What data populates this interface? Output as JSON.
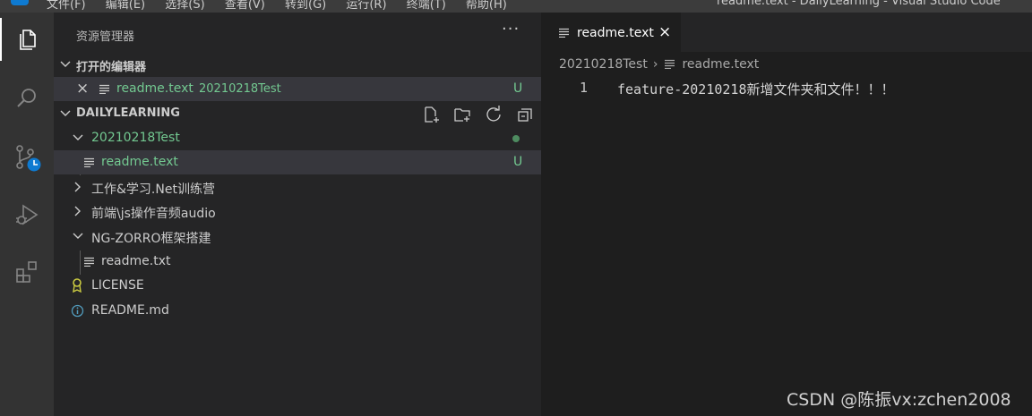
{
  "menubar": {
    "items": [
      "文件(F)",
      "编辑(E)",
      "选择(S)",
      "查看(V)",
      "转到(G)",
      "运行(R)",
      "终端(T)",
      "帮助(H)"
    ],
    "window_title": "readme.text - DailyLearning - Visual Studio Code"
  },
  "activity_bar": {
    "icons": [
      "explorer-icon",
      "search-icon",
      "source-control-icon",
      "run-debug-icon",
      "extensions-icon"
    ],
    "accent_color": "#ffffff",
    "badge_color": "#0e7ad1"
  },
  "explorer": {
    "title": "资源管理器",
    "more": "···",
    "open_editors": {
      "title": "打开的编辑器",
      "items": [
        {
          "close": "×",
          "name": "readme.text",
          "folder": "20210218Test",
          "status": "U"
        }
      ]
    },
    "workspace": {
      "title": "DAILYLEARNING",
      "tools": [
        "new-file-icon",
        "new-folder-icon",
        "refresh-icon",
        "collapse-all-icon"
      ],
      "tree": [
        {
          "name": "20210218Test",
          "type": "folder",
          "expanded": true,
          "status": "dot"
        },
        {
          "name": "readme.text",
          "type": "file",
          "status": "U"
        },
        {
          "name": "工作&学习.Net训练营",
          "type": "folder",
          "expanded": false
        },
        {
          "name": "前端\\js操作音频audio",
          "type": "folder",
          "expanded": false
        },
        {
          "name": "NG-ZORRO框架搭建",
          "type": "folder",
          "expanded": true
        },
        {
          "name": "readme.txt",
          "type": "file"
        },
        {
          "name": "LICENSE",
          "type": "file",
          "icon": "license-icon"
        },
        {
          "name": "README.md",
          "type": "file",
          "icon": "info-icon"
        }
      ]
    }
  },
  "editor": {
    "tab": {
      "label": "readme.text",
      "close": "×"
    },
    "breadcrumb": {
      "folder": "20210218Test",
      "separator": "›",
      "file": "readme.text"
    },
    "lines": [
      {
        "number": "1",
        "text": "feature-20210218新增文件夹和文件！！！"
      }
    ]
  },
  "watermark": "CSDN @陈振vx:zchen2008",
  "colors": {
    "untracked_green": "#73c991",
    "selection": "#37373d",
    "sidebar_bg": "#252526",
    "editor_bg": "#1e1e1e"
  }
}
